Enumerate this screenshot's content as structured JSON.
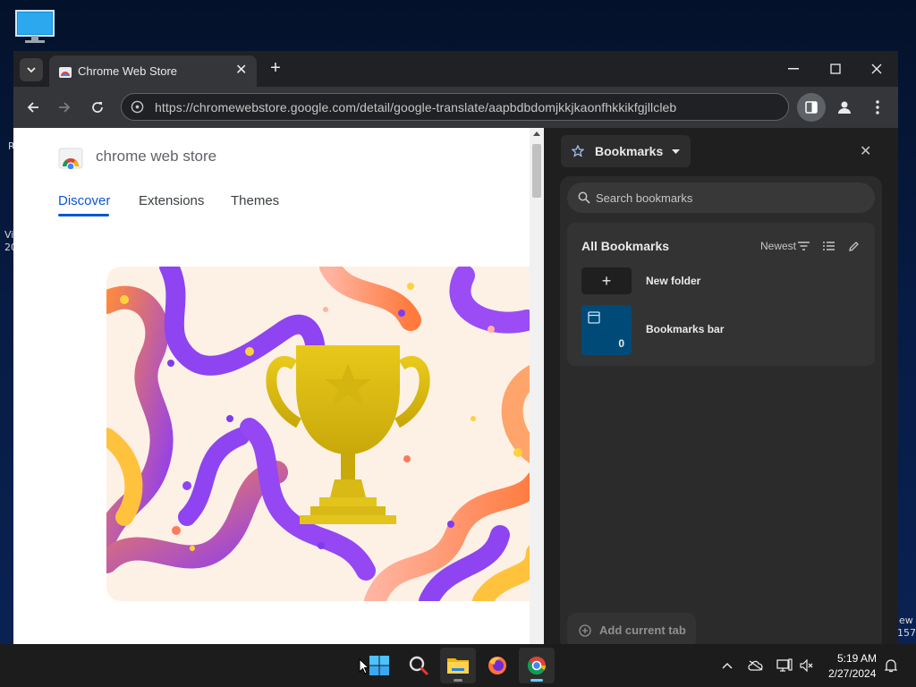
{
  "desktop": {
    "fragments": [
      "R",
      "Vi",
      "20",
      "ew",
      "157"
    ]
  },
  "browser": {
    "tab": {
      "title": "Chrome Web Store"
    },
    "url": "https://chromewebstore.google.com/detail/google-translate/aapbdbdomjkkjkaonfhkkikfgjllcleb"
  },
  "page": {
    "store_name": "chrome web store",
    "nav": [
      "Discover",
      "Extensions",
      "Themes"
    ],
    "active_nav": "Discover"
  },
  "side_panel": {
    "title": "Bookmarks",
    "search_placeholder": "Search bookmarks",
    "section_title": "All Bookmarks",
    "sort_label": "Newest",
    "new_folder_label": "New folder",
    "folders": [
      {
        "label": "Bookmarks bar",
        "count": "0"
      }
    ],
    "add_current_tab": "Add current tab"
  },
  "taskbar": {
    "time": "5:19 AM",
    "date": "2/27/2024"
  },
  "colors": {
    "accent": "#0b57d0",
    "folder_tile": "#004a77",
    "taskbar_active": "#60cdff"
  }
}
